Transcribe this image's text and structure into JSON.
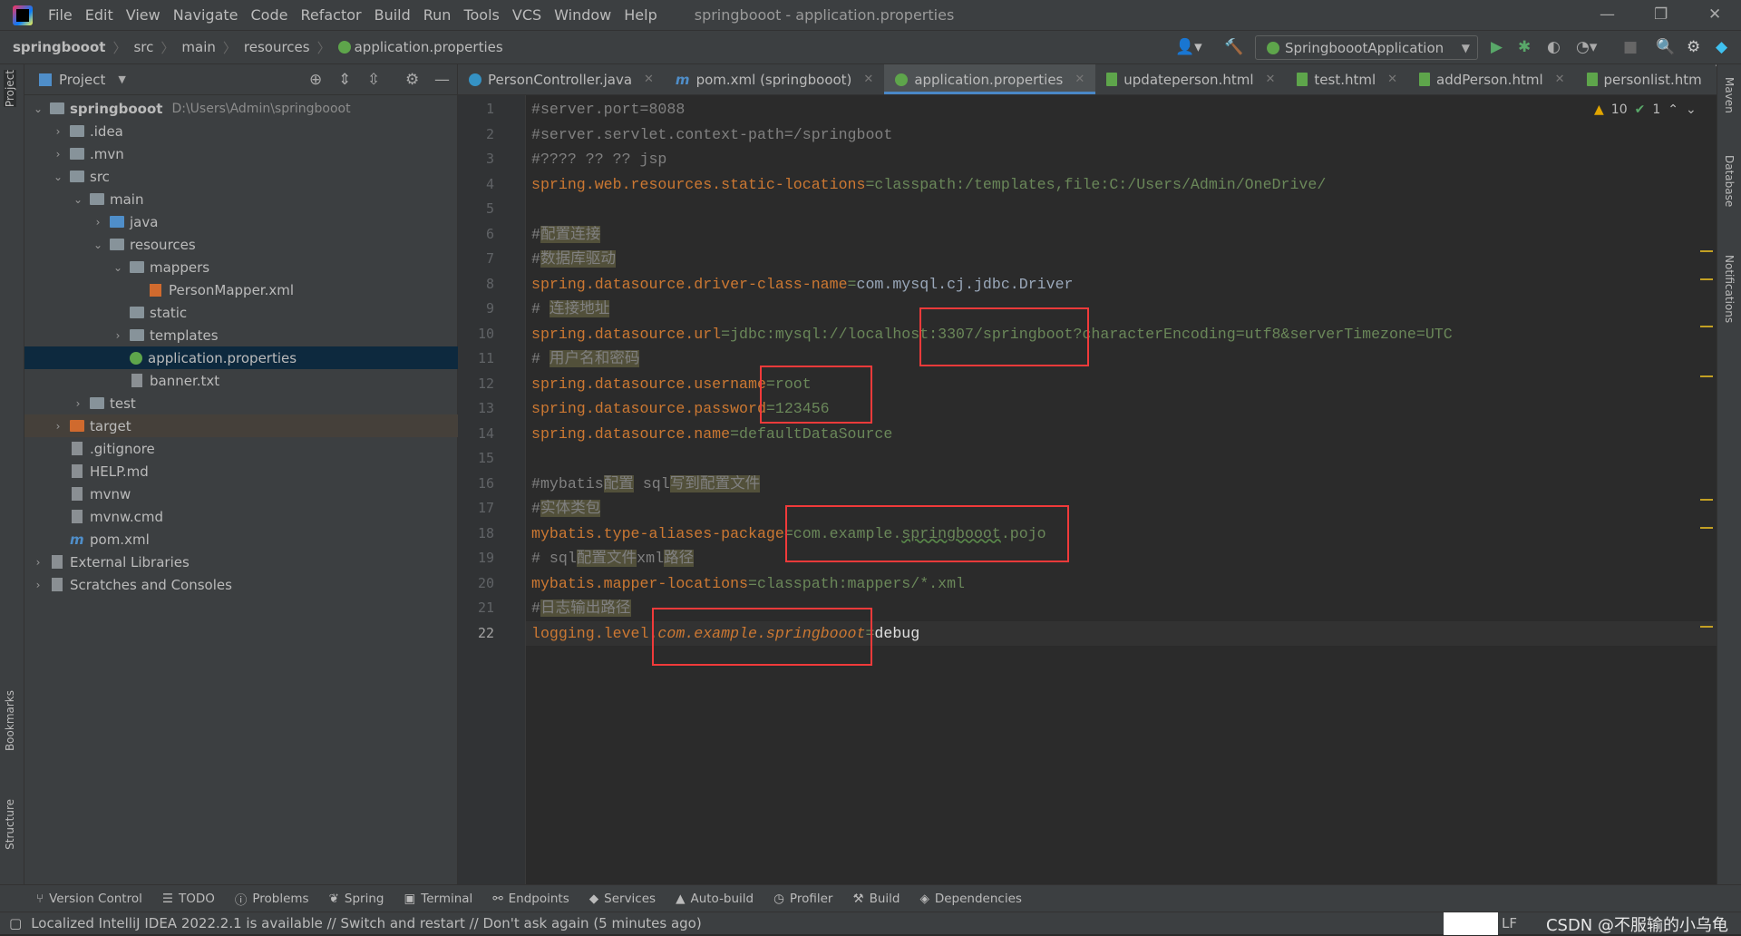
{
  "window": {
    "title": "springbooot - application.properties",
    "menu": [
      "File",
      "Edit",
      "View",
      "Navigate",
      "Code",
      "Refactor",
      "Build",
      "Run",
      "Tools",
      "VCS",
      "Window",
      "Help"
    ]
  },
  "breadcrumb": [
    "springbooot",
    "src",
    "main",
    "resources",
    "application.properties"
  ],
  "run_config": "SpringboootApplication",
  "project_panel": {
    "title": "Project",
    "tree": [
      {
        "label": "springbooot",
        "path": "D:\\Users\\Admin\\springbooot",
        "depth": 0,
        "arrow": "down",
        "icon": "folder-module",
        "bold": true
      },
      {
        "label": ".idea",
        "depth": 1,
        "arrow": "right",
        "icon": "folder"
      },
      {
        "label": ".mvn",
        "depth": 1,
        "arrow": "right",
        "icon": "folder"
      },
      {
        "label": "src",
        "depth": 1,
        "arrow": "down",
        "icon": "folder"
      },
      {
        "label": "main",
        "depth": 2,
        "arrow": "down",
        "icon": "folder"
      },
      {
        "label": "java",
        "depth": 3,
        "arrow": "right",
        "icon": "folder-source"
      },
      {
        "label": "resources",
        "depth": 3,
        "arrow": "down",
        "icon": "folder-resources"
      },
      {
        "label": "mappers",
        "depth": 4,
        "arrow": "down",
        "icon": "folder"
      },
      {
        "label": "PersonMapper.xml",
        "depth": 5,
        "icon": "xml-file"
      },
      {
        "label": "static",
        "depth": 4,
        "icon": "folder"
      },
      {
        "label": "templates",
        "depth": 4,
        "arrow": "right",
        "icon": "folder"
      },
      {
        "label": "application.properties",
        "depth": 4,
        "icon": "properties-file",
        "selected": true
      },
      {
        "label": "banner.txt",
        "depth": 4,
        "icon": "text-file"
      },
      {
        "label": "test",
        "depth": 2,
        "arrow": "right",
        "icon": "folder"
      },
      {
        "label": "target",
        "depth": 1,
        "arrow": "right",
        "icon": "folder-excluded",
        "highlight": true
      },
      {
        "label": ".gitignore",
        "depth": 1,
        "icon": "text-file"
      },
      {
        "label": "HELP.md",
        "depth": 1,
        "icon": "text-file"
      },
      {
        "label": "mvnw",
        "depth": 1,
        "icon": "text-file"
      },
      {
        "label": "mvnw.cmd",
        "depth": 1,
        "icon": "text-file"
      },
      {
        "label": "pom.xml",
        "depth": 1,
        "icon": "maven-file"
      },
      {
        "label": "External Libraries",
        "depth": 0,
        "arrow": "right",
        "icon": "library"
      },
      {
        "label": "Scratches and Consoles",
        "depth": 0,
        "arrow": "right",
        "icon": "scratches"
      }
    ]
  },
  "tabs": [
    {
      "label": "PersonController.java",
      "icon": "c"
    },
    {
      "label": "pom.xml (springbooot)",
      "icon": "m"
    },
    {
      "label": "application.properties",
      "icon": "p",
      "active": true
    },
    {
      "label": "updateperson.html",
      "icon": "h"
    },
    {
      "label": "test.html",
      "icon": "h"
    },
    {
      "label": "addPerson.html",
      "icon": "h"
    },
    {
      "label": "personlist.htm",
      "icon": "h"
    }
  ],
  "inspections": {
    "warnings": "10",
    "ok": "1"
  },
  "editor": {
    "current_line": 22,
    "lines": [
      [
        [
          "cmt",
          "#server.port=8088"
        ]
      ],
      [
        [
          "cmt",
          "#server.servlet.context-path=/springboot"
        ]
      ],
      [
        [
          "cmt",
          "#???? ?? ?? jsp"
        ]
      ],
      [
        [
          "key",
          "spring.web.resources.static-locations"
        ],
        [
          "val",
          "=classpath:/templates,file:C:/Users/Admin/OneDrive/"
        ]
      ],
      [],
      [
        [
          "cmt",
          "#"
        ],
        [
          "hl",
          "配置连接"
        ]
      ],
      [
        [
          "cmt",
          "#"
        ],
        [
          "hl",
          "数据库驱动"
        ]
      ],
      [
        [
          "key",
          "spring.datasource.driver-class-name"
        ],
        [
          "val",
          "="
        ],
        [
          "cls",
          "com.mysql.cj.jdbc.Driver"
        ]
      ],
      [
        [
          "cmt",
          "# "
        ],
        [
          "hl",
          "连接地址"
        ]
      ],
      [
        [
          "key",
          "spring.datasource.url"
        ],
        [
          "val",
          "=jdbc:mysql://localhost:3307/springboot?characterEncoding=utf8&serverTimezone=UTC"
        ]
      ],
      [
        [
          "cmt",
          "# "
        ],
        [
          "hl",
          "用户名和密码"
        ]
      ],
      [
        [
          "key",
          "spring.datasource.username"
        ],
        [
          "val",
          "=root"
        ]
      ],
      [
        [
          "key",
          "spring.datasource.password"
        ],
        [
          "val",
          "=123456"
        ]
      ],
      [
        [
          "key",
          "spring.datasource.name"
        ],
        [
          "val",
          "=defaultDataSource"
        ]
      ],
      [],
      [
        [
          "cmt",
          "#mybatis"
        ],
        [
          "hl",
          "配置"
        ],
        [
          "cmt",
          " sql"
        ],
        [
          "hl",
          "写到配置文件"
        ]
      ],
      [
        [
          "cmt",
          "#"
        ],
        [
          "hl",
          "实体类包"
        ]
      ],
      [
        [
          "key",
          "mybatis.type-aliases-package"
        ],
        [
          "val",
          "=com.example."
        ],
        [
          "und",
          "springbooot"
        ],
        [
          "val",
          ".pojo"
        ]
      ],
      [
        [
          "cmt",
          "# sql"
        ],
        [
          "hl",
          "配置文件"
        ],
        [
          "cmt",
          "xml"
        ],
        [
          "hl",
          "路径"
        ]
      ],
      [
        [
          "key",
          "mybatis.mapper-locations"
        ],
        [
          "val",
          "=classpath:mappers/*.xml"
        ]
      ],
      [
        [
          "cmt",
          "#"
        ],
        [
          "hl",
          "日志输出路径"
        ]
      ],
      [
        [
          "key",
          "logging.level."
        ],
        [
          "ital",
          "com.example.springbooot"
        ],
        [
          "val",
          "="
        ],
        [
          "plain",
          "debug"
        ]
      ]
    ]
  },
  "left_strip": [
    "Project",
    "Bookmarks",
    "Structure"
  ],
  "right_strip": [
    "Maven",
    "Database",
    "Notifications"
  ],
  "tool_windows": [
    "Version Control",
    "TODO",
    "Problems",
    "Spring",
    "Terminal",
    "Endpoints",
    "Services",
    "Auto-build",
    "Profiler",
    "Build",
    "Dependencies"
  ],
  "status": {
    "message": "Localized IntelliJ IDEA 2022.2.1 is available // Switch and restart // Don't ask again (5 minutes ago)",
    "line_sep": "LF",
    "watermark": "CSDN @不服输的小乌龟"
  }
}
